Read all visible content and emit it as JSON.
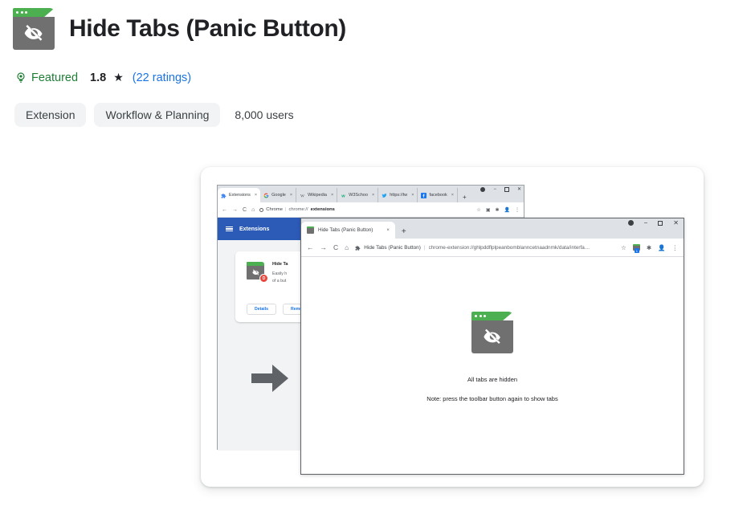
{
  "header": {
    "title": "Hide Tabs (Panic Button)",
    "icon": "hide-tabs-extension-icon"
  },
  "meta": {
    "featured_label": "Featured",
    "featured_icon": "award-badge-icon",
    "rating_value": "1.8",
    "star_glyph": "★",
    "ratings_link": "(22 ratings)",
    "featured_color": "#1e7e34",
    "link_color": "#1a73e8"
  },
  "chips": {
    "type_label": "Extension",
    "category_label": "Workflow & Planning",
    "users_label": "8,000 users"
  },
  "screenshot": {
    "back_window": {
      "tabs": [
        {
          "title": "Extensions",
          "favicon": "puzzle-icon",
          "close": "×",
          "active": true
        },
        {
          "title": "Google",
          "favicon": "google-icon",
          "close": "×",
          "active": false
        },
        {
          "title": "Wikipedia",
          "favicon": "wikipedia-icon",
          "close": "×",
          "active": false
        },
        {
          "title": "W3Schoo",
          "favicon": "w3schools-icon",
          "close": "×",
          "active": false
        },
        {
          "title": "https://tw",
          "favicon": "twitter-icon",
          "close": "×",
          "active": false
        },
        {
          "title": "facebook",
          "favicon": "facebook-icon",
          "close": "×",
          "active": false
        }
      ],
      "new_tab": "+",
      "window_controls": {
        "minimize": "−",
        "maximize": "□",
        "close": "✕"
      },
      "nav": {
        "back": "←",
        "forward": "→",
        "reload": "C",
        "home": "⌂"
      },
      "url_prefix": "Chrome",
      "url_dim": "chrome://",
      "url_strong": "extensions",
      "omni_right": {
        "bookmark": "☆",
        "cast": "▣",
        "extensions": "✱",
        "profile": "👤",
        "menu": "⋮"
      },
      "extensions_page": {
        "header_title": "Extensions",
        "menu_icon": "hamburger-menu-icon",
        "card": {
          "name": "Hide Ta",
          "desc_line1": "Easily h",
          "desc_line2": "of a but",
          "badge_text": "D",
          "details_button": "Details",
          "remove_button": "Remo"
        },
        "arrow_icon": "right-arrow-icon"
      }
    },
    "front_window": {
      "tab": {
        "title": "Hide Tabs (Panic Button)",
        "favicon": "hide-tabs-icon",
        "close": "×"
      },
      "new_tab": "+",
      "window_controls": {
        "minimize": "−",
        "maximize": "□",
        "close": "✕"
      },
      "nav": {
        "back": "←",
        "forward": "→",
        "reload": "C",
        "home": "⌂"
      },
      "site_label": "Hide Tabs (Panic Button)",
      "url": "chrome-extension://ghlpddflplpeanbomblanncetnaadnmk/data/interfa…",
      "omni_right": {
        "bookmark": "☆",
        "extension_badge": "1",
        "extensions": "✱",
        "profile": "👤",
        "menu": "⋮"
      },
      "page": {
        "icon": "hide-tabs-extension-icon",
        "message": "All tabs are hidden",
        "note": "Note: press the toolbar button again to show tabs"
      }
    }
  }
}
